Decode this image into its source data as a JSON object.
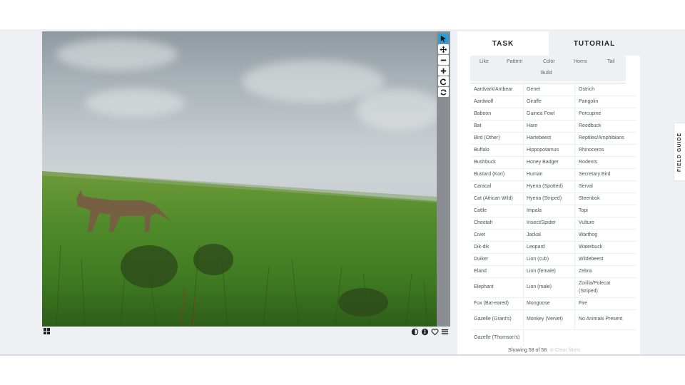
{
  "toolbar": {
    "buttons": [
      {
        "name": "pointer",
        "icon": "arrow-pointer-icon",
        "active": true
      },
      {
        "name": "pan",
        "icon": "move-arrows-icon",
        "active": false
      },
      {
        "name": "zoom-out",
        "icon": "minus-icon",
        "active": false
      },
      {
        "name": "zoom-in",
        "icon": "plus-icon",
        "active": false
      },
      {
        "name": "rotate",
        "icon": "rotate-icon",
        "active": false
      },
      {
        "name": "reset",
        "icon": "reset-icon",
        "active": false
      }
    ]
  },
  "image_tools": [
    "contrast-icon",
    "info-icon",
    "heart-icon",
    "collection-list-icon"
  ],
  "tabs": {
    "task": "TASK",
    "tutorial": "TUTORIAL",
    "active": "task"
  },
  "filters": {
    "like": "Like",
    "pattern": "Pattern",
    "color": "Color",
    "horns": "Horns",
    "tail": "Tail",
    "build": "Build"
  },
  "species": {
    "r0": [
      "Aardvark/Antbear",
      "Genet",
      "Ostrich"
    ],
    "r1": [
      "Aardwolf",
      "Giraffe",
      "Pangolin"
    ],
    "r2": [
      "Baboon",
      "Guinea Fowl",
      "Porcupine"
    ],
    "r3": [
      "Bat",
      "Hare",
      "Reedbuck"
    ],
    "r4": [
      "Bird (Other)",
      "Hartebeest",
      "Reptiles/Amphibians"
    ],
    "r5": [
      "Buffalo",
      "Hippopotamus",
      "Rhinoceros"
    ],
    "r6": [
      "Bushbuck",
      "Honey Badger",
      "Rodents"
    ],
    "r7": [
      "Bustard (Kori)",
      "Human",
      "Secretary Bird"
    ],
    "r8": [
      "Caracal",
      "Hyena (Spotted)",
      "Serval"
    ],
    "r9": [
      "Cat (African Wild)",
      "Hyena (Striped)",
      "Steenbok"
    ],
    "r10": [
      "Cattle",
      "Impala",
      "Topi"
    ],
    "r11": [
      "Cheetah",
      "Insect/Spider",
      "Vulture"
    ],
    "r12": [
      "Civet",
      "Jackal",
      "Warthog"
    ],
    "r13": [
      "Dik-dik",
      "Leopard",
      "Waterbuck"
    ],
    "r14": [
      "Duiker",
      "Lion (cub)",
      "Wildebeest"
    ],
    "r15": [
      "Eland",
      "Lion (female)",
      "Zebra"
    ],
    "r16": [
      "Elephant",
      "Lion (male)",
      "Zorilla/Polecat (Striped)"
    ],
    "r17": [
      "Fox (Bat-eared)",
      "Mongoose",
      "Fire"
    ],
    "r18": [
      "Gazelle (Grant's)",
      "Monkey (Vervet)",
      "No Animals Present"
    ],
    "r19": [
      "Gazelle (Thomson's)",
      "",
      ""
    ]
  },
  "footer": {
    "showing": "Showing 58 of 58",
    "clear": "Clear filters"
  },
  "field_guide": "FIELD GUIDE",
  "colors": {
    "accent": "#2f9bd9",
    "toolbar": "#8a8d91",
    "background": "#eef0f3"
  }
}
